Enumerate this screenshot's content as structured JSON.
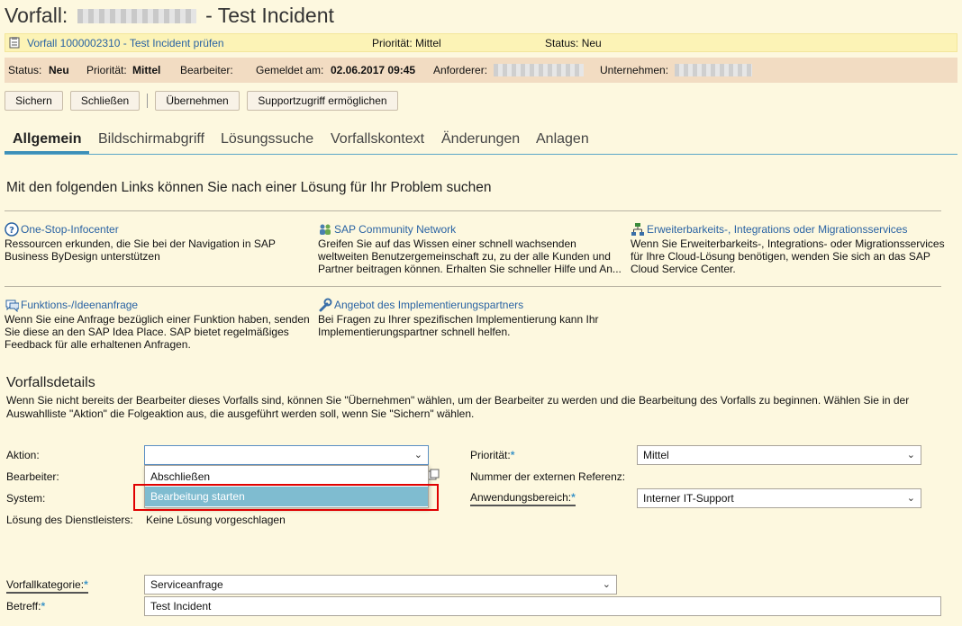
{
  "header": {
    "title_prefix": "Vorfall:",
    "title_suffix": "- Test Incident"
  },
  "task_bar": {
    "link": "Vorfall 1000002310 - Test Incident prüfen",
    "priority": "Priorität: Mittel",
    "status": "Status: Neu"
  },
  "info_bar": {
    "status_label": "Status:",
    "status_value": "Neu",
    "priority_label": "Priorität:",
    "priority_value": "Mittel",
    "processor_label": "Bearbeiter:",
    "reported_label": "Gemeldet am:",
    "reported_value": "02.06.2017 09:45",
    "requester_label": "Anforderer:",
    "company_label": "Unternehmen:"
  },
  "toolbar": {
    "save": "Sichern",
    "close": "Schließen",
    "take_over": "Übernehmen",
    "support_access": "Supportzugriff ermöglichen"
  },
  "tabs": [
    "Allgemein",
    "Bildschirmabgriff",
    "Lösungssuche",
    "Vorfallskontext",
    "Änderungen",
    "Anlagen"
  ],
  "links_section": {
    "heading": "Mit den folgenden Links können Sie nach einer Lösung für Ihr Problem suchen",
    "cards": [
      {
        "title": "One-Stop-Infocenter",
        "icon": "help-icon",
        "desc": "Ressourcen erkunden, die Sie bei der Navigation in SAP Business ByDesign unterstützen"
      },
      {
        "title": "SAP Community Network",
        "icon": "community-icon",
        "desc": "Greifen Sie auf das Wissen einer schnell wachsenden weltweiten Benutzergemeinschaft zu, zu der alle Kunden und Partner beitragen können. Erhalten Sie schneller Hilfe und An..."
      },
      {
        "title": "Erweiterbarkeits-, Integrations oder Migrationsservices",
        "icon": "hierarchy-icon",
        "desc": "Wenn Sie Erweiterbarkeits-, Integrations- oder Migrationsservices für Ihre Cloud-Lösung benötigen, wenden Sie sich an das SAP Cloud Service Center."
      },
      {
        "title": "Funktions-/Ideenanfrage",
        "icon": "idea-icon",
        "desc": "Wenn Sie eine Anfrage bezüglich einer Funktion haben, senden Sie diese an den SAP Idea Place. SAP bietet regelmäßiges Feedback für alle erhaltenen Anfragen."
      },
      {
        "title": "Angebot des Implementierungspartners",
        "icon": "wrench-icon",
        "desc": "Bei Fragen zu Ihrer spezifischen Implementierung kann Ihr Implementierungspartner schnell helfen."
      }
    ]
  },
  "details": {
    "title": "Vorfallsdetails",
    "desc": "Wenn Sie nicht bereits der Bearbeiter dieses Vorfalls sind, können Sie \"Übernehmen\" wählen, um der Bearbeiter zu werden und die Bearbeitung des Vorfalls zu beginnen. Wählen Sie in der Auswahlliste \"Aktion\" die Folgeaktion aus, die ausgeführt werden soll, wenn Sie \"Sichern\" wählen.",
    "action_label": "Aktion:",
    "action_value": "",
    "action_options": [
      "Abschließen",
      "Bearbeitung starten"
    ],
    "processor_label": "Bearbeiter:",
    "system_label": "System:",
    "provider_solution_label": "Lösung des Dienstleisters:",
    "provider_solution_value": "Keine Lösung vorgeschlagen",
    "priority_label": "Priorität:",
    "priority_value": "Mittel",
    "ext_ref_label": "Nummer der externen Referenz:",
    "app_area_label": "Anwendungsbereich:",
    "app_area_value": "Interner IT-Support",
    "category_label": "Vorfallkategorie:",
    "category_value": "Serviceanfrage",
    "subject_label": "Betreff:",
    "subject_value": "Test Incident",
    "required_mark": "*"
  },
  "colors": {
    "accent": "#3c8fb8",
    "link": "#2a63a3",
    "highlight_box": "#e00000",
    "selected_option": "#7fbcd0"
  }
}
